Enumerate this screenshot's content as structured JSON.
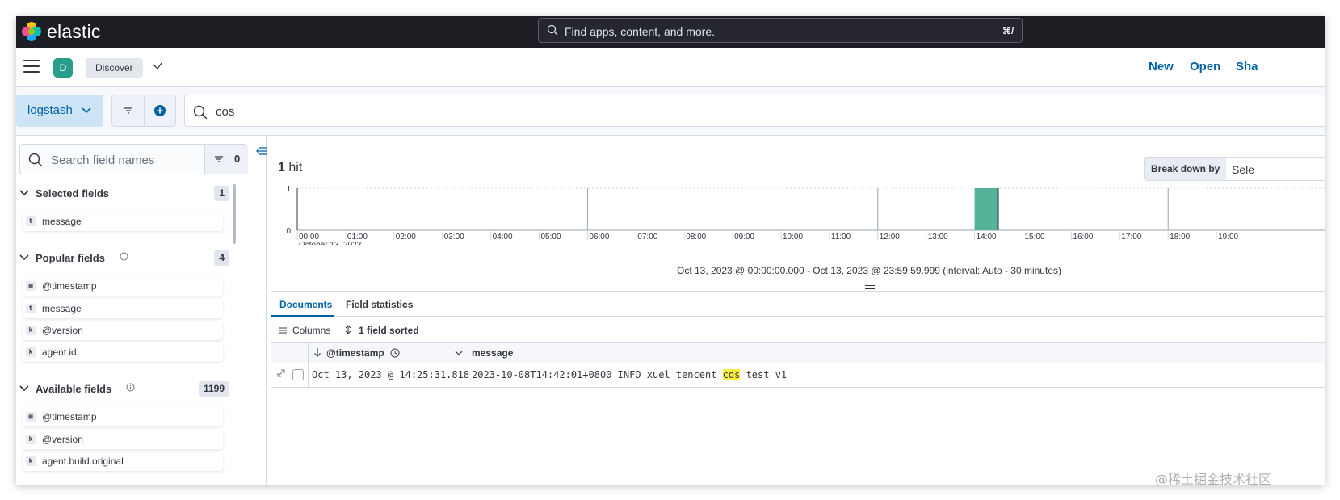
{
  "header": {
    "logo_text": "elastic",
    "search_placeholder": "Find apps, content, and more.",
    "search_shortcut": "⌘/"
  },
  "appbar": {
    "space_initial": "D",
    "breadcrumb": "Discover",
    "menu": [
      "New",
      "Open",
      "Sha"
    ]
  },
  "querybar": {
    "dataview": "logstash",
    "query": "cos"
  },
  "sidebar": {
    "search_placeholder": "Search field names",
    "filter_count": "0",
    "selected": {
      "title": "Selected fields",
      "count": "1",
      "fields": [
        {
          "type": "t",
          "name": "message"
        }
      ]
    },
    "popular": {
      "title": "Popular fields",
      "count": "4",
      "fields": [
        {
          "type": "cal",
          "name": "@timestamp"
        },
        {
          "type": "t",
          "name": "message"
        },
        {
          "type": "k",
          "name": "@version"
        },
        {
          "type": "k",
          "name": "agent.id"
        }
      ]
    },
    "available": {
      "title": "Available fields",
      "count": "1199",
      "fields": [
        {
          "type": "cal",
          "name": "@timestamp"
        },
        {
          "type": "k",
          "name": "@version"
        },
        {
          "type": "k",
          "name": "agent.build.original"
        }
      ]
    }
  },
  "main": {
    "hits_count": "1",
    "hits_label": "hit",
    "breakdown_label": "Break down by",
    "breakdown_select": "Sele",
    "range_text": "Oct 13, 2023 @ 00:00:00.000 - Oct 13, 2023 @ 23:59:59.999 (interval: Auto - 30 minutes)",
    "tabs": [
      "Documents",
      "Field statistics"
    ],
    "toolbar": {
      "columns": "Columns",
      "sorted": "1 field sorted"
    },
    "grid": {
      "headers": [
        "@timestamp",
        "message"
      ],
      "row": {
        "timestamp": "Oct 13, 2023 @ 14:25:31.818",
        "message_pre": "2023-10-08T14:42:01+0800 INFO xuel tencent ",
        "message_hl": "cos",
        "message_post": " test v1"
      }
    }
  },
  "chart_data": {
    "type": "bar",
    "x": [
      "00:00",
      "01:00",
      "02:00",
      "03:00",
      "04:00",
      "05:00",
      "06:00",
      "07:00",
      "08:00",
      "09:00",
      "10:00",
      "11:00",
      "12:00",
      "13:00",
      "14:00",
      "15:00",
      "16:00",
      "17:00",
      "18:00",
      "19:00"
    ],
    "date_label": "October 13, 2023",
    "bars": [
      {
        "start": "14:00",
        "end": "14:30",
        "value": 1
      }
    ],
    "yticks": [
      "0",
      "1"
    ],
    "ylim": [
      0,
      1
    ],
    "bar_color": "#54b399"
  },
  "watermark": "@稀土掘金技术社区"
}
